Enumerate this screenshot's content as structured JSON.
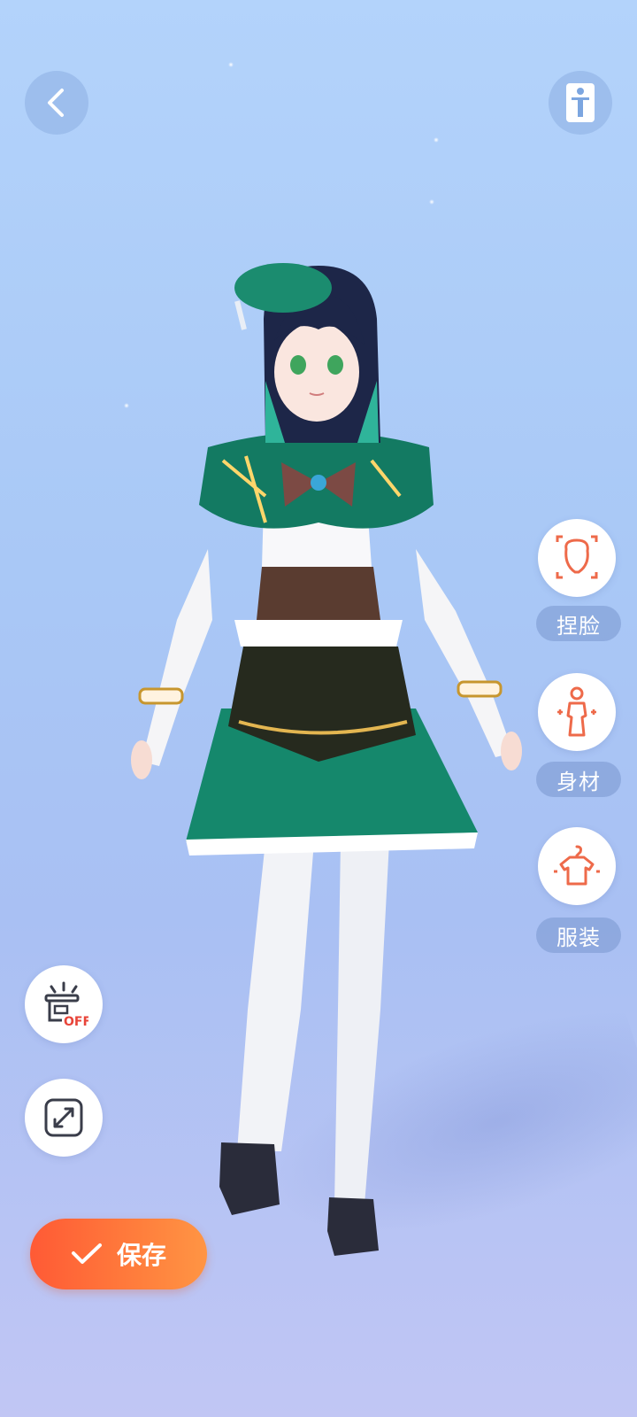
{
  "top_bar": {
    "back_icon": "chevron-left-icon",
    "pose_icon": "standing-figure-icon"
  },
  "side_menu": {
    "items": [
      {
        "label": "捏脸",
        "icon": "face-outline-icon"
      },
      {
        "label": "身材",
        "icon": "body-outline-icon"
      },
      {
        "label": "服装",
        "icon": "clothes-hanger-icon"
      }
    ]
  },
  "left_tools": {
    "off_badge": "OFF",
    "off_icon": "spotlight-off-icon",
    "expand_icon": "expand-arrows-icon"
  },
  "save_button": {
    "label": "保存",
    "icon": "checkmark-icon"
  },
  "colors": {
    "accent_orange": "#ff6a3a",
    "off_red": "#e8453a",
    "bg_top": "#b3d3fb",
    "bg_bottom": "#c1c6f4"
  }
}
